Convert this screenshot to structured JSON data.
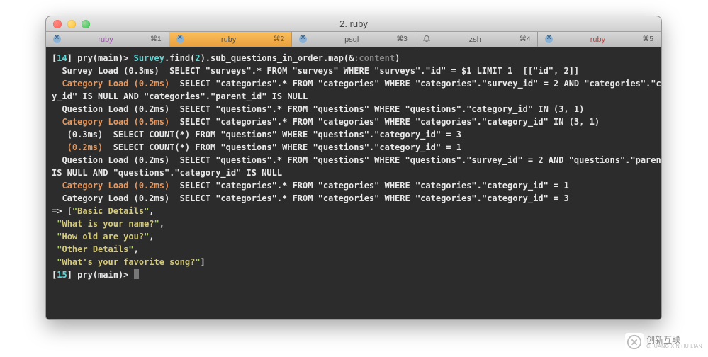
{
  "window": {
    "title": "2. ruby"
  },
  "tabs": [
    {
      "label": "ruby",
      "shortcut": "⌘1",
      "active": false,
      "labelClass": "ruby-purple",
      "hasBell": false,
      "hasClose": true,
      "closeStyle": "blue"
    },
    {
      "label": "ruby",
      "shortcut": "⌘2",
      "active": true,
      "labelClass": "",
      "hasBell": false,
      "hasClose": true,
      "closeStyle": "blue"
    },
    {
      "label": "psql",
      "shortcut": "⌘3",
      "active": false,
      "labelClass": "",
      "hasBell": false,
      "hasClose": true,
      "closeStyle": "blue"
    },
    {
      "label": "zsh",
      "shortcut": "⌘4",
      "active": false,
      "labelClass": "",
      "hasBell": true,
      "hasClose": false,
      "closeStyle": ""
    },
    {
      "label": "ruby",
      "shortcut": "⌘5",
      "active": false,
      "labelClass": "ruby-red",
      "hasBell": false,
      "hasClose": true,
      "closeStyle": "blue"
    }
  ],
  "lines": [
    [
      {
        "t": "[",
        "c": "white"
      },
      {
        "t": "14",
        "c": "cyan"
      },
      {
        "t": "] pry(main)> ",
        "c": "white"
      },
      {
        "t": "Survey",
        "c": "cyan"
      },
      {
        "t": ".find(",
        "c": "white"
      },
      {
        "t": "2",
        "c": "cyan"
      },
      {
        "t": ").sub_questions_in_order.map(&",
        "c": "white"
      },
      {
        "t": ":content",
        "c": "gray"
      },
      {
        "t": ")",
        "c": "white"
      }
    ],
    [
      {
        "t": "  Survey Load (0.3ms)",
        "c": "white"
      },
      {
        "t": "  SELECT \"surveys\".* FROM \"surveys\" WHERE \"surveys\".\"id\" = $1 LIMIT 1  [[\"id\", 2]]",
        "c": "white"
      }
    ],
    [
      {
        "t": "  Category Load (0.2ms)",
        "c": "orange"
      },
      {
        "t": "  SELECT \"categories\".* FROM \"categories\" WHERE \"categories\".\"survey_id\" = 2 AND \"categories\".\"categor",
        "c": "white"
      }
    ],
    [
      {
        "t": "y_id\" IS NULL AND \"categories\".\"parent_id\" IS NULL",
        "c": "white"
      }
    ],
    [
      {
        "t": "  Question Load (0.2ms)",
        "c": "white"
      },
      {
        "t": "  SELECT \"questions\".* FROM \"questions\" WHERE \"questions\".\"category_id\" IN (3, 1)",
        "c": "white"
      }
    ],
    [
      {
        "t": "  Category Load (0.5ms)",
        "c": "orange"
      },
      {
        "t": "  SELECT \"categories\".* FROM \"categories\" WHERE \"categories\".\"category_id\" IN (3, 1)",
        "c": "white"
      }
    ],
    [
      {
        "t": "   (0.3ms)",
        "c": "white"
      },
      {
        "t": "  SELECT COUNT(*) FROM \"questions\" WHERE \"questions\".\"category_id\" = 3",
        "c": "white"
      }
    ],
    [
      {
        "t": "   (0.2ms)",
        "c": "orange"
      },
      {
        "t": "  SELECT COUNT(*) FROM \"questions\" WHERE \"questions\".\"category_id\" = 1",
        "c": "white"
      }
    ],
    [
      {
        "t": "  Question Load (0.2ms)",
        "c": "white"
      },
      {
        "t": "  SELECT \"questions\".* FROM \"questions\" WHERE \"questions\".\"survey_id\" = 2 AND \"questions\".\"parent_id\"",
        "c": "white"
      }
    ],
    [
      {
        "t": "IS NULL AND \"questions\".\"category_id\" IS NULL",
        "c": "white"
      }
    ],
    [
      {
        "t": "  Category Load (0.2ms)",
        "c": "orange"
      },
      {
        "t": "  SELECT \"categories\".* FROM \"categories\" WHERE \"categories\".\"category_id\" = 1",
        "c": "white"
      }
    ],
    [
      {
        "t": "  Category Load (0.2ms)",
        "c": "white"
      },
      {
        "t": "  SELECT \"categories\".* FROM \"categories\" WHERE \"categories\".\"category_id\" = 3",
        "c": "white"
      }
    ],
    [
      {
        "t": "=> [",
        "c": "white"
      },
      {
        "t": "\"",
        "c": "lime"
      },
      {
        "t": "Basic Details",
        "c": "yellowish"
      },
      {
        "t": "\"",
        "c": "lime"
      },
      {
        "t": ",",
        "c": "white"
      }
    ],
    [
      {
        "t": " ",
        "c": "white"
      },
      {
        "t": "\"",
        "c": "lime"
      },
      {
        "t": "What is your name?",
        "c": "yellowish"
      },
      {
        "t": "\"",
        "c": "lime"
      },
      {
        "t": ",",
        "c": "white"
      }
    ],
    [
      {
        "t": " ",
        "c": "white"
      },
      {
        "t": "\"",
        "c": "lime"
      },
      {
        "t": "How old are you?",
        "c": "yellowish"
      },
      {
        "t": "\"",
        "c": "lime"
      },
      {
        "t": ",",
        "c": "white"
      }
    ],
    [
      {
        "t": " ",
        "c": "white"
      },
      {
        "t": "\"",
        "c": "lime"
      },
      {
        "t": "Other Details",
        "c": "yellowish"
      },
      {
        "t": "\"",
        "c": "lime"
      },
      {
        "t": ",",
        "c": "white"
      }
    ],
    [
      {
        "t": " ",
        "c": "white"
      },
      {
        "t": "\"",
        "c": "lime"
      },
      {
        "t": "What's your favorite song?",
        "c": "yellowish"
      },
      {
        "t": "\"",
        "c": "lime"
      },
      {
        "t": "]",
        "c": "white"
      }
    ],
    [
      {
        "t": "[",
        "c": "white"
      },
      {
        "t": "15",
        "c": "cyan"
      },
      {
        "t": "] pry(main)> ",
        "c": "white"
      },
      {
        "cursor": true
      }
    ]
  ],
  "watermark": {
    "main": "创新互联",
    "sub": "CHUANG XIN HU LIAN"
  }
}
